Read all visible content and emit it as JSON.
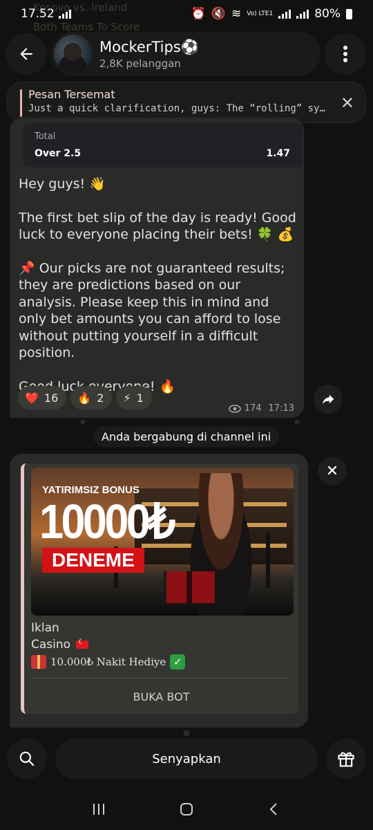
{
  "status_bar": {
    "time": "17.52",
    "battery": "80%",
    "network": "Vo) LTE1"
  },
  "background": {
    "faded_line_1": "Kosovo vs. Ireland",
    "faded_line_2": "Both Teams To Score"
  },
  "header": {
    "channel_name": "MockerTips⚽",
    "subscribers": "2,8K pelanggan"
  },
  "pinned": {
    "title": "Pesan Tersemat",
    "text": "Just a quick clarification, guys:  The “rolling” system..."
  },
  "bet_card": {
    "market": "Total",
    "selection": "Over 2.5",
    "odds": "1.47"
  },
  "message": {
    "line1": "Hey guys! 👋",
    "line2": "The first bet slip of the day is ready! Good luck to everyone placing their bets! 🍀 💰",
    "line3": "📌 Our picks are not guaranteed results; they are predictions based on our analysis. Please keep this in mind and only bet amounts you can afford to lose without putting yourself in a difficult position.",
    "line4": "Good luck everyone! 🔥",
    "reactions": [
      {
        "emoji": "❤️",
        "count": "16"
      },
      {
        "emoji": "🔥",
        "count": "2"
      },
      {
        "emoji": "⚡",
        "count": "1"
      }
    ],
    "views": "174",
    "time": "17:13"
  },
  "joined_notice": "Anda bergabung di channel ini",
  "ad": {
    "image_bonus": "YATIRIMSIZ BONUS",
    "image_amount": "10000₺",
    "image_deneme": "DENEME",
    "label": "Iklan",
    "title": "Casino",
    "description": "10.000₺ Nakit Hediye",
    "button": "BUKA BOT"
  },
  "bottom_bar": {
    "mute_label": "Senyapkan"
  }
}
